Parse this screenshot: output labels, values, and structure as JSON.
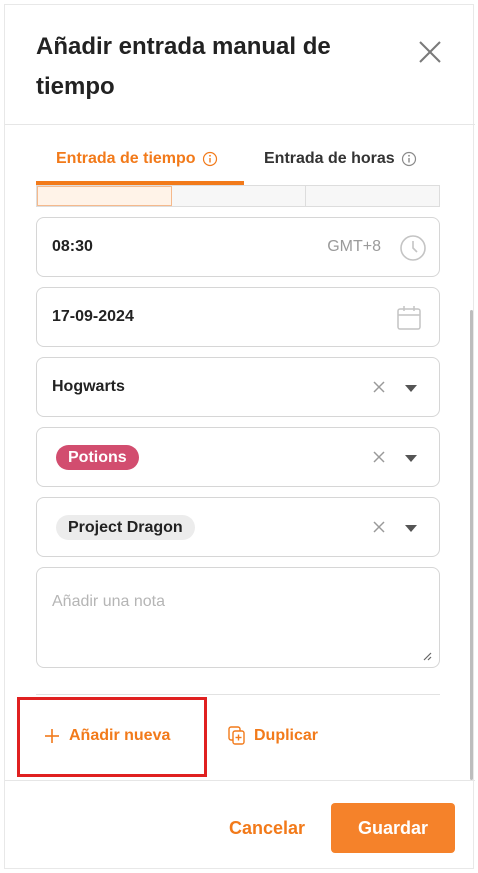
{
  "dialog": {
    "title": "Añadir entrada manual de tiempo",
    "close_icon": "close-icon"
  },
  "tabs": [
    {
      "label": "Entrada de tiempo",
      "active": true,
      "icon": "info-icon"
    },
    {
      "label": "Entrada de horas",
      "active": false,
      "icon": "info-icon"
    }
  ],
  "segments": {
    "count": 3,
    "selected_index": 0
  },
  "time": {
    "value": "08:30",
    "timezone": "GMT+8",
    "icon": "clock-icon"
  },
  "date": {
    "value": "17-09-2024",
    "icon": "calendar-icon"
  },
  "client": {
    "value": "Hogwarts"
  },
  "project": {
    "tag": "Potions",
    "tag_color": "#d24d6f"
  },
  "task": {
    "tag": "Project Dragon",
    "tag_color": "#ececec"
  },
  "note": {
    "placeholder": "Añadir una nota",
    "value": ""
  },
  "actions": {
    "add_new_label": "Añadir nueva",
    "duplicate_label": "Duplicar"
  },
  "footer": {
    "cancel_label": "Cancelar",
    "save_label": "Guardar"
  },
  "colors": {
    "accent": "#f27a1a",
    "save_button": "#f5822a",
    "highlight_box": "#e02020"
  }
}
